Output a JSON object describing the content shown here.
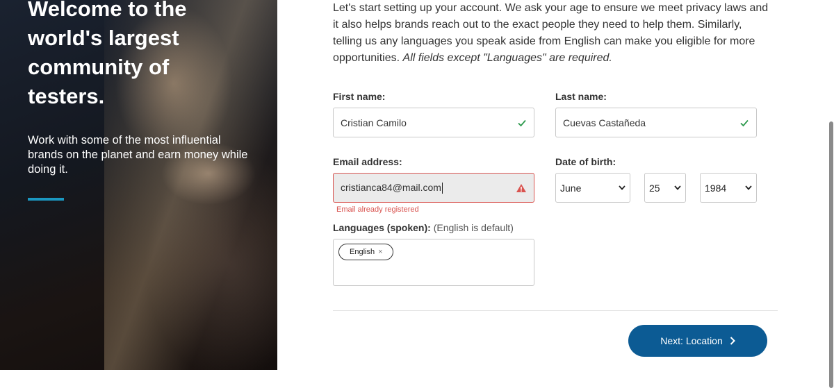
{
  "hero": {
    "title": "Welcome to the world's largest community of testers.",
    "subtitle": "Work with some of the most influential brands on the planet and earn money while doing it.",
    "accent_color": "#1b97c0"
  },
  "intro": {
    "text": "Let's start setting up your account. We ask your age to ensure we meet privacy laws and it also helps brands reach out to the exact people they need to help them. Similarly, telling us any languages you speak aside from English can make you eligible for more opportunities. ",
    "emphasis": "All fields except \"Languages\" are required."
  },
  "form": {
    "first_name": {
      "label": "First name:",
      "value": "Cristian Camilo",
      "status_icon": "check-icon"
    },
    "last_name": {
      "label": "Last name:",
      "value": "Cuevas Castañeda",
      "status_icon": "check-icon"
    },
    "email": {
      "label": "Email address:",
      "value": "cristianca84@mail.com",
      "status_icon": "warning-icon",
      "error": "Email already registered"
    },
    "dob": {
      "label": "Date of birth:",
      "month": "June",
      "day": "25",
      "year": "1984"
    },
    "languages": {
      "label": "Languages (spoken):",
      "note": "(English is default)",
      "tags": [
        "English"
      ],
      "remove_glyph": "×"
    }
  },
  "actions": {
    "next_label": "Next: Location"
  },
  "colors": {
    "success": "#2e9a4e",
    "error": "#d9534f",
    "primary": "#0c5b94"
  }
}
